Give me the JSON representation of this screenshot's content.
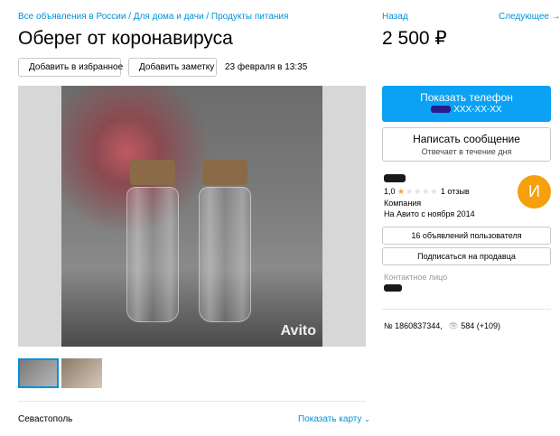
{
  "breadcrumb": "Все объявления в России / Для дома и дачи / Продукты питания",
  "title": "Оберег от коронавируса",
  "nav": {
    "prev": "Назад",
    "next": "Следующее →"
  },
  "price": "2 500 ₽",
  "actions": {
    "favorite": "Добавить в избранное",
    "note": "Добавить заметку"
  },
  "date": "23 февраля в 13:35",
  "photo": {
    "watermark": "Avito"
  },
  "location": {
    "city": "Севастополь",
    "map_link": "Показать карту"
  },
  "phone_button": {
    "label": "Показать телефон",
    "masked": "XXX-XX-XX"
  },
  "message_button": {
    "label": "Написать сообщение",
    "sub": "Отвечает в течение дня"
  },
  "seller": {
    "rating": "1,0",
    "stars_filled": 1,
    "reviews": "1 отзыв",
    "type": "Компания",
    "since": "На Авито с ноября 2014",
    "avatar_letter": "И",
    "avatar_color": "#f5a00c",
    "listings_button": "16 объявлений пользователя",
    "subscribe_button": "Подписаться на продавца",
    "contact_label": "Контактное лицо"
  },
  "ad": {
    "number": "№ 1860837344,",
    "views": "584 (+109)"
  },
  "colors": {
    "accent": "#0091d9",
    "phone_button_bg": "#0ba2f3"
  },
  "icons": {
    "favorite": "heart-icon",
    "note": "note-icon",
    "views": "eye-icon",
    "map": "chevron-down-icon"
  }
}
